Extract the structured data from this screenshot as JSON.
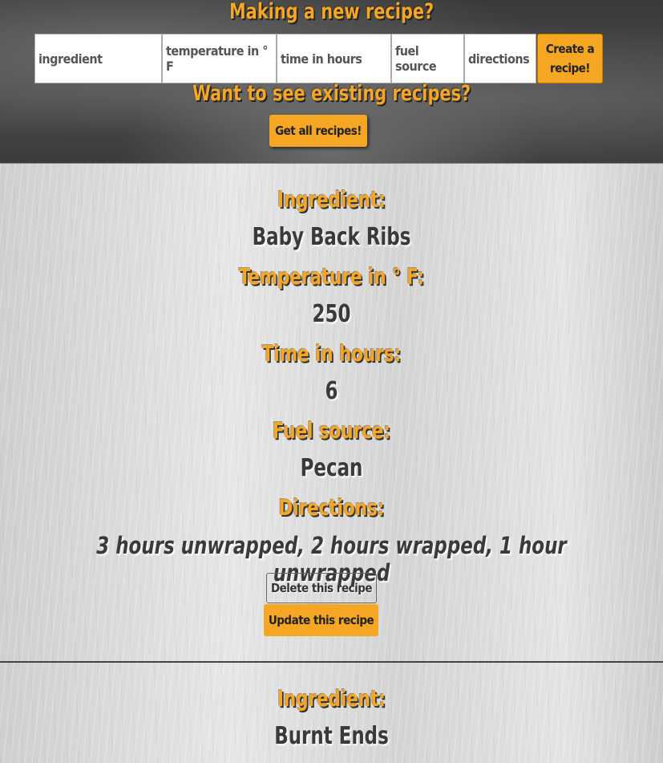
{
  "header": {
    "title": "Making a new recipe?",
    "subtitle": "Want to see existing recipes?",
    "get_all_label": "Get all recipes!"
  },
  "form": {
    "ingredient_placeholder": "ingredient",
    "temperature_placeholder": "temperature in ° F",
    "time_placeholder": "time in hours",
    "fuel_placeholder": "fuel source",
    "directions_placeholder": "directions",
    "create_label": "Create a recipe!"
  },
  "labels": {
    "ingredient": "Ingredient:",
    "temperature": "Temperature in ° F:",
    "time": "Time in hours:",
    "fuel": "Fuel source:",
    "directions": "Directions:"
  },
  "recipes": [
    {
      "ingredient": "Baby Back Ribs",
      "temperature": "250",
      "time": "6",
      "fuel": "Pecan",
      "directions": "3 hours unwrapped, 2 hours wrapped, 1 hour unwrapped",
      "delete_label": "Delete this recipe",
      "update_label": "Update this recipe"
    },
    {
      "ingredient": "Burnt Ends"
    }
  ]
}
